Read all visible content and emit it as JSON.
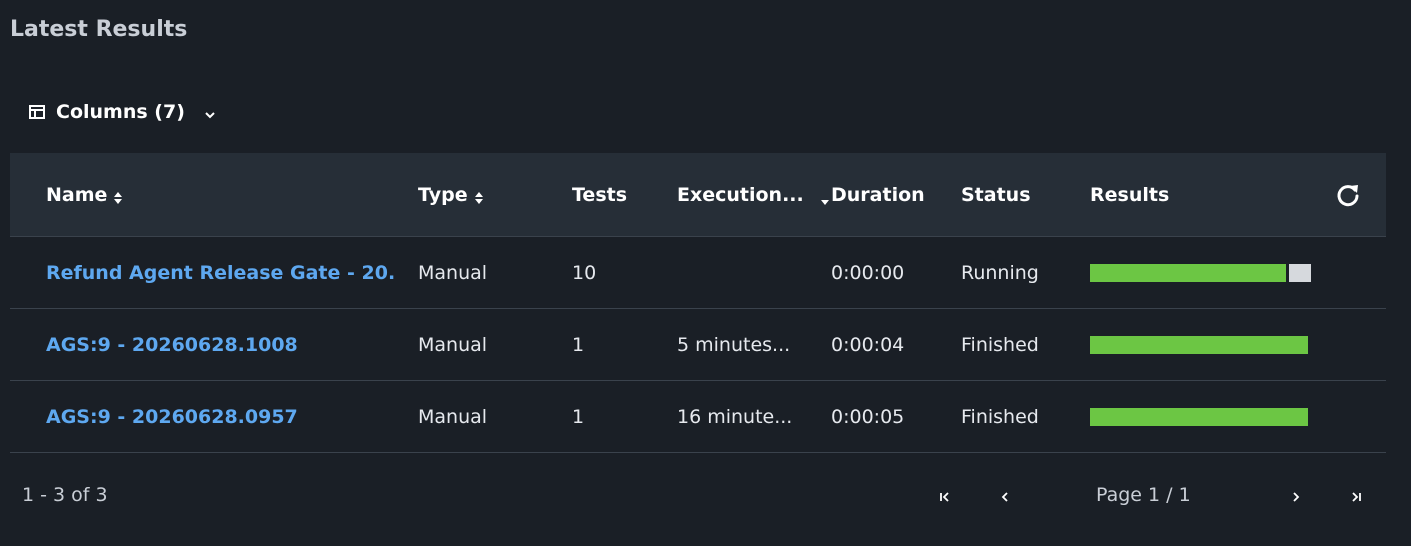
{
  "header": {
    "title": "Latest Results"
  },
  "toolbar": {
    "columns_label": "Columns (7)"
  },
  "table": {
    "columns": {
      "name": "Name",
      "type": "Type",
      "tests": "Tests",
      "execution": "Execution...",
      "duration": "Duration",
      "status": "Status",
      "results": "Results"
    },
    "rows": [
      {
        "name": "Refund Agent Release Gate - 20...",
        "type": "Manual",
        "tests": "10",
        "execution": "",
        "duration": "0:00:00",
        "status": "Running",
        "results": {
          "passed_fraction": 0.9,
          "pending_fraction": 0.1
        }
      },
      {
        "name": "AGS:9 - 20260628.1008",
        "type": "Manual",
        "tests": "1",
        "execution": "5 minutes...",
        "duration": "0:00:04",
        "status": "Finished",
        "results": {
          "passed_fraction": 1.0,
          "pending_fraction": 0
        }
      },
      {
        "name": "AGS:9 - 20260628.0957",
        "type": "Manual",
        "tests": "1",
        "execution": "16 minute...",
        "duration": "0:00:05",
        "status": "Finished",
        "results": {
          "passed_fraction": 1.0,
          "pending_fraction": 0
        }
      }
    ]
  },
  "pagination": {
    "count_label": "1 - 3 of 3",
    "page_label": "Page 1 / 1"
  },
  "colors": {
    "background": "#1a1f26",
    "header_bg": "#262e37",
    "link": "#5ea8f0",
    "pass": "#6cc644",
    "pending": "#d6d9dd"
  },
  "icons": {
    "columns": "table-icon",
    "dropdown": "chevron-down-icon",
    "sort": "sort-icon",
    "sort_desc": "caret-down-icon",
    "refresh": "refresh-icon",
    "first": "first-page-icon",
    "prev": "prev-page-icon",
    "next": "next-page-icon",
    "last": "last-page-icon"
  }
}
